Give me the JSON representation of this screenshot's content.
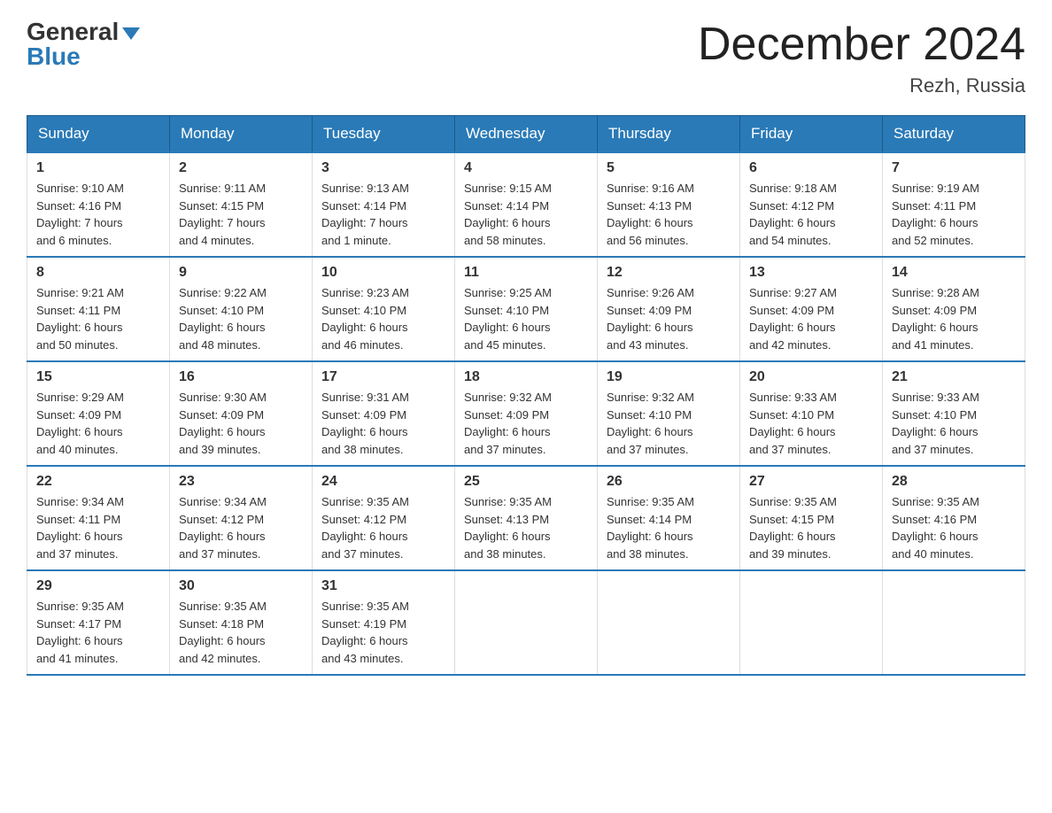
{
  "header": {
    "logo_general": "General",
    "logo_blue": "Blue",
    "month_title": "December 2024",
    "location": "Rezh, Russia"
  },
  "days_of_week": [
    "Sunday",
    "Monday",
    "Tuesday",
    "Wednesday",
    "Thursday",
    "Friday",
    "Saturday"
  ],
  "weeks": [
    [
      {
        "day": "1",
        "sunrise": "Sunrise: 9:10 AM",
        "sunset": "Sunset: 4:16 PM",
        "daylight": "Daylight: 7 hours and 6 minutes."
      },
      {
        "day": "2",
        "sunrise": "Sunrise: 9:11 AM",
        "sunset": "Sunset: 4:15 PM",
        "daylight": "Daylight: 7 hours and 4 minutes."
      },
      {
        "day": "3",
        "sunrise": "Sunrise: 9:13 AM",
        "sunset": "Sunset: 4:14 PM",
        "daylight": "Daylight: 7 hours and 1 minute."
      },
      {
        "day": "4",
        "sunrise": "Sunrise: 9:15 AM",
        "sunset": "Sunset: 4:14 PM",
        "daylight": "Daylight: 6 hours and 58 minutes."
      },
      {
        "day": "5",
        "sunrise": "Sunrise: 9:16 AM",
        "sunset": "Sunset: 4:13 PM",
        "daylight": "Daylight: 6 hours and 56 minutes."
      },
      {
        "day": "6",
        "sunrise": "Sunrise: 9:18 AM",
        "sunset": "Sunset: 4:12 PM",
        "daylight": "Daylight: 6 hours and 54 minutes."
      },
      {
        "day": "7",
        "sunrise": "Sunrise: 9:19 AM",
        "sunset": "Sunset: 4:11 PM",
        "daylight": "Daylight: 6 hours and 52 minutes."
      }
    ],
    [
      {
        "day": "8",
        "sunrise": "Sunrise: 9:21 AM",
        "sunset": "Sunset: 4:11 PM",
        "daylight": "Daylight: 6 hours and 50 minutes."
      },
      {
        "day": "9",
        "sunrise": "Sunrise: 9:22 AM",
        "sunset": "Sunset: 4:10 PM",
        "daylight": "Daylight: 6 hours and 48 minutes."
      },
      {
        "day": "10",
        "sunrise": "Sunrise: 9:23 AM",
        "sunset": "Sunset: 4:10 PM",
        "daylight": "Daylight: 6 hours and 46 minutes."
      },
      {
        "day": "11",
        "sunrise": "Sunrise: 9:25 AM",
        "sunset": "Sunset: 4:10 PM",
        "daylight": "Daylight: 6 hours and 45 minutes."
      },
      {
        "day": "12",
        "sunrise": "Sunrise: 9:26 AM",
        "sunset": "Sunset: 4:09 PM",
        "daylight": "Daylight: 6 hours and 43 minutes."
      },
      {
        "day": "13",
        "sunrise": "Sunrise: 9:27 AM",
        "sunset": "Sunset: 4:09 PM",
        "daylight": "Daylight: 6 hours and 42 minutes."
      },
      {
        "day": "14",
        "sunrise": "Sunrise: 9:28 AM",
        "sunset": "Sunset: 4:09 PM",
        "daylight": "Daylight: 6 hours and 41 minutes."
      }
    ],
    [
      {
        "day": "15",
        "sunrise": "Sunrise: 9:29 AM",
        "sunset": "Sunset: 4:09 PM",
        "daylight": "Daylight: 6 hours and 40 minutes."
      },
      {
        "day": "16",
        "sunrise": "Sunrise: 9:30 AM",
        "sunset": "Sunset: 4:09 PM",
        "daylight": "Daylight: 6 hours and 39 minutes."
      },
      {
        "day": "17",
        "sunrise": "Sunrise: 9:31 AM",
        "sunset": "Sunset: 4:09 PM",
        "daylight": "Daylight: 6 hours and 38 minutes."
      },
      {
        "day": "18",
        "sunrise": "Sunrise: 9:32 AM",
        "sunset": "Sunset: 4:09 PM",
        "daylight": "Daylight: 6 hours and 37 minutes."
      },
      {
        "day": "19",
        "sunrise": "Sunrise: 9:32 AM",
        "sunset": "Sunset: 4:10 PM",
        "daylight": "Daylight: 6 hours and 37 minutes."
      },
      {
        "day": "20",
        "sunrise": "Sunrise: 9:33 AM",
        "sunset": "Sunset: 4:10 PM",
        "daylight": "Daylight: 6 hours and 37 minutes."
      },
      {
        "day": "21",
        "sunrise": "Sunrise: 9:33 AM",
        "sunset": "Sunset: 4:10 PM",
        "daylight": "Daylight: 6 hours and 37 minutes."
      }
    ],
    [
      {
        "day": "22",
        "sunrise": "Sunrise: 9:34 AM",
        "sunset": "Sunset: 4:11 PM",
        "daylight": "Daylight: 6 hours and 37 minutes."
      },
      {
        "day": "23",
        "sunrise": "Sunrise: 9:34 AM",
        "sunset": "Sunset: 4:12 PM",
        "daylight": "Daylight: 6 hours and 37 minutes."
      },
      {
        "day": "24",
        "sunrise": "Sunrise: 9:35 AM",
        "sunset": "Sunset: 4:12 PM",
        "daylight": "Daylight: 6 hours and 37 minutes."
      },
      {
        "day": "25",
        "sunrise": "Sunrise: 9:35 AM",
        "sunset": "Sunset: 4:13 PM",
        "daylight": "Daylight: 6 hours and 38 minutes."
      },
      {
        "day": "26",
        "sunrise": "Sunrise: 9:35 AM",
        "sunset": "Sunset: 4:14 PM",
        "daylight": "Daylight: 6 hours and 38 minutes."
      },
      {
        "day": "27",
        "sunrise": "Sunrise: 9:35 AM",
        "sunset": "Sunset: 4:15 PM",
        "daylight": "Daylight: 6 hours and 39 minutes."
      },
      {
        "day": "28",
        "sunrise": "Sunrise: 9:35 AM",
        "sunset": "Sunset: 4:16 PM",
        "daylight": "Daylight: 6 hours and 40 minutes."
      }
    ],
    [
      {
        "day": "29",
        "sunrise": "Sunrise: 9:35 AM",
        "sunset": "Sunset: 4:17 PM",
        "daylight": "Daylight: 6 hours and 41 minutes."
      },
      {
        "day": "30",
        "sunrise": "Sunrise: 9:35 AM",
        "sunset": "Sunset: 4:18 PM",
        "daylight": "Daylight: 6 hours and 42 minutes."
      },
      {
        "day": "31",
        "sunrise": "Sunrise: 9:35 AM",
        "sunset": "Sunset: 4:19 PM",
        "daylight": "Daylight: 6 hours and 43 minutes."
      },
      null,
      null,
      null,
      null
    ]
  ]
}
